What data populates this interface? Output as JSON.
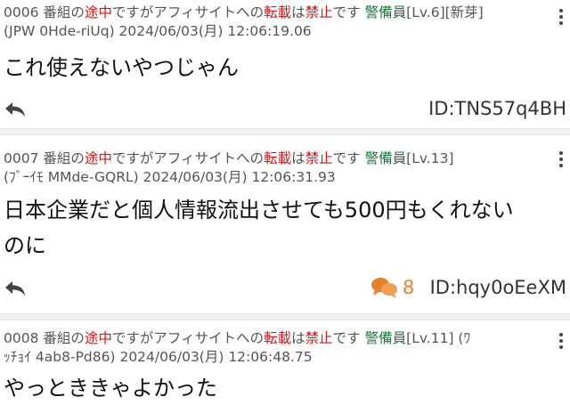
{
  "posts": [
    {
      "number": "0006",
      "title_prefix": "番組の",
      "title_red": "途中",
      "title_mid": "ですがアフィサイトへの",
      "title_red2": "転載",
      "title_mid2": "は",
      "title_red3": "禁止",
      "title_end": "です",
      "name": "警備員",
      "level": "[Lv.6][新芽]",
      "meta": "(JPW 0Hde-riUq) 2024/06/03(月) 12:06:19.06",
      "body": "これ使えないやつじゃん",
      "id": "ID:TNS57q4BH"
    },
    {
      "number": "0007",
      "title_prefix": "番組の",
      "title_red": "途中",
      "title_mid": "ですがアフィサイトへの",
      "title_red2": "転載",
      "title_mid2": "は",
      "title_red3": "禁止",
      "title_end": "です",
      "name": "警備員",
      "level": "[Lv.13]",
      "meta": "(ﾌﾞｰｲﾓ MMde-GQRL) 2024/06/03(月) 12:06:31.93",
      "body_line1": "日本企業だと個人情報流出させても500円もくれない",
      "body_line2": "のに",
      "reply_count": "8",
      "id": "ID:hqy0oEeXM"
    },
    {
      "number": "0008",
      "title_prefix": "番組の",
      "title_red": "途中",
      "title_mid": "ですがアフィサイトへの",
      "title_red2": "転載",
      "title_mid2": "は",
      "title_red3": "禁止",
      "title_end": "です",
      "name": "警備員",
      "level": "[Lv.11] (ﾜ",
      "meta": "ｯﾁｮｲ 4ab8-Pd86) 2024/06/03(月) 12:06:48.75",
      "body": "やっとききゃよかった"
    }
  ]
}
